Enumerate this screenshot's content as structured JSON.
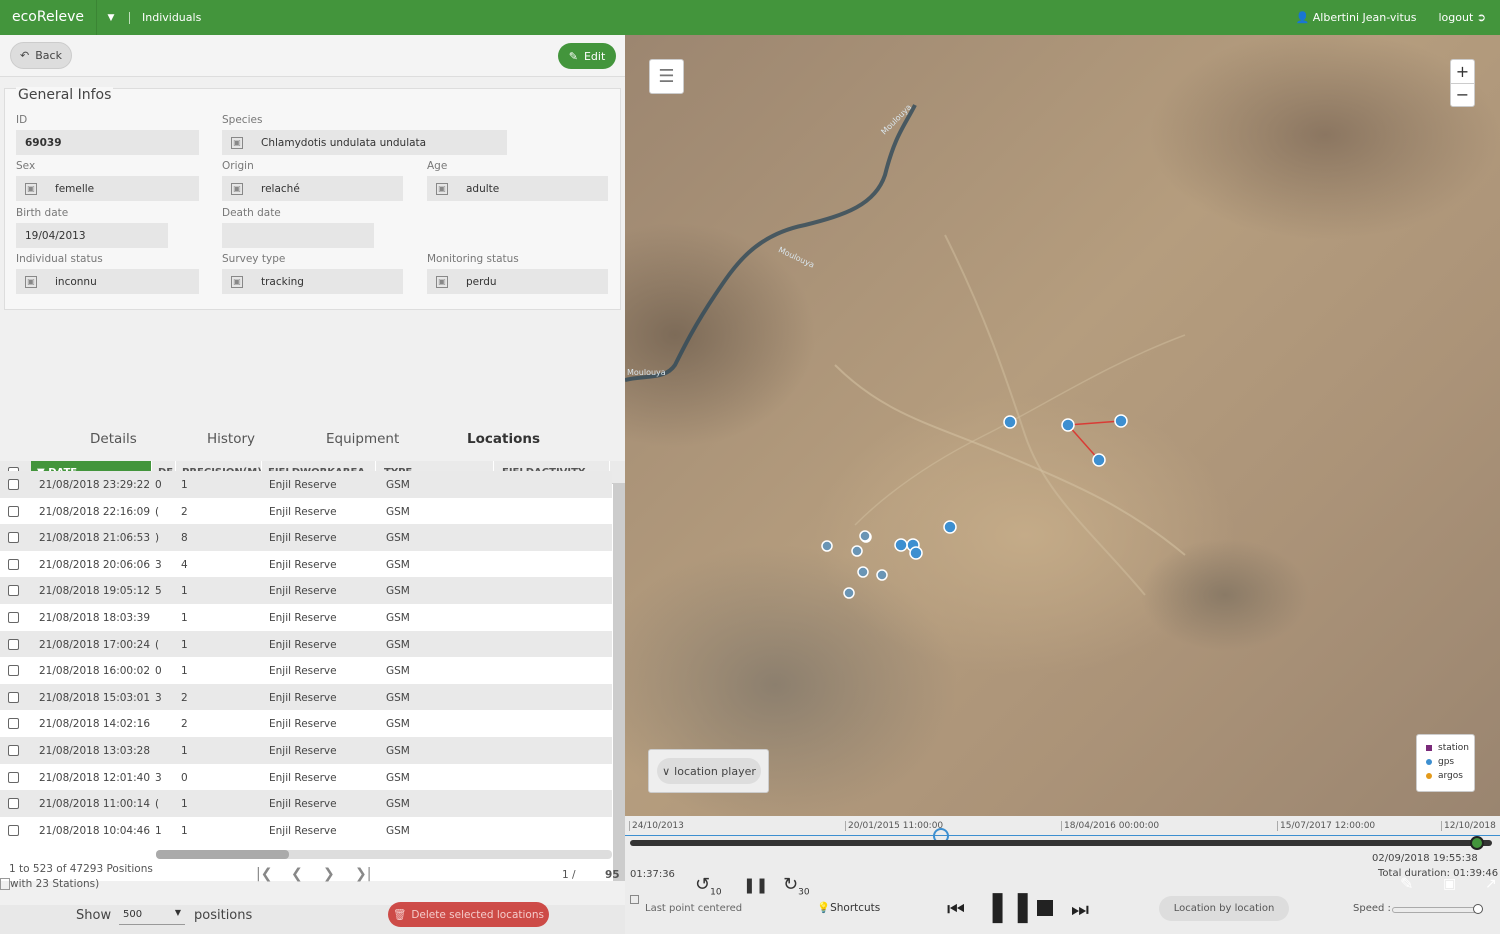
{
  "topbar": {
    "brand": "ecoReleve",
    "breadcrumb": "Individuals",
    "user": "Albertini Jean-vitus",
    "logout": "logout"
  },
  "actions": {
    "back": "Back",
    "edit": "Edit"
  },
  "general": {
    "title": "General Infos",
    "id_label": "ID",
    "id_value": "69039",
    "species_label": "Species",
    "species_value": "Chlamydotis undulata undulata",
    "sex_label": "Sex",
    "sex_value": "femelle",
    "origin_label": "Origin",
    "origin_value": "relaché",
    "age_label": "Age",
    "age_value": "adulte",
    "birth_label": "Birth date",
    "birth_value": "19/04/2013",
    "death_label": "Death date",
    "death_value": "",
    "status_label": "Individual status",
    "status_value": "inconnu",
    "survey_label": "Survey type",
    "survey_value": "tracking",
    "monitoring_label": "Monitoring status",
    "monitoring_value": "perdu"
  },
  "tabs": [
    "Details",
    "History",
    "Equipment",
    "Locations"
  ],
  "grid": {
    "columns": [
      "DATE",
      "DE",
      "PRECISION(M)",
      "FIELDWORKAREA",
      "TYPE",
      "FIELDACTIVITY"
    ],
    "rows": [
      [
        "21/08/2018 23:29:22",
        "0",
        "1",
        "Enjil Reserve",
        "GSM"
      ],
      [
        "21/08/2018 22:16:09",
        "(",
        "2",
        "Enjil Reserve",
        "GSM"
      ],
      [
        "21/08/2018 21:06:53",
        ")",
        "8",
        "Enjil Reserve",
        "GSM"
      ],
      [
        "21/08/2018 20:06:06",
        "3",
        "4",
        "Enjil Reserve",
        "GSM"
      ],
      [
        "21/08/2018 19:05:12",
        "5",
        "1",
        "Enjil Reserve",
        "GSM"
      ],
      [
        "21/08/2018 18:03:39",
        "",
        "1",
        "Enjil Reserve",
        "GSM"
      ],
      [
        "21/08/2018 17:00:24",
        "(",
        "1",
        "Enjil Reserve",
        "GSM"
      ],
      [
        "21/08/2018 16:00:02",
        "0",
        "1",
        "Enjil Reserve",
        "GSM"
      ],
      [
        "21/08/2018 15:03:01",
        "3",
        "2",
        "Enjil Reserve",
        "GSM"
      ],
      [
        "21/08/2018 14:02:16",
        "",
        "2",
        "Enjil Reserve",
        "GSM"
      ],
      [
        "21/08/2018 13:03:28",
        "",
        "1",
        "Enjil Reserve",
        "GSM"
      ],
      [
        "21/08/2018 12:01:40",
        "3",
        "0",
        "Enjil Reserve",
        "GSM"
      ],
      [
        "21/08/2018 11:00:14",
        "(",
        "1",
        "Enjil Reserve",
        "GSM"
      ],
      [
        "21/08/2018 10:04:46",
        "1",
        "1",
        "Enjil Reserve",
        "GSM"
      ]
    ]
  },
  "pager": {
    "summary": "1 to 523 of 47293 Positions",
    "summary2": "with 23 Stations)",
    "page": "1 /",
    "total": "95"
  },
  "footer": {
    "show": "Show",
    "show_value": "500",
    "positions": "positions",
    "delete": "Delete selected locations"
  },
  "map": {
    "river_labels": [
      "Moulouya",
      "Moulouya",
      "Moulouya"
    ],
    "location_player": "location player",
    "legend": [
      {
        "label": "station",
        "color": "#7a2a7a"
      },
      {
        "label": "gps",
        "color": "#3d8fd0"
      },
      {
        "label": "argos",
        "color": "#e39a1b"
      }
    ]
  },
  "timeline": {
    "ticks": [
      "24/10/2013",
      "20/01/2015 11:00:00",
      "18/04/2016 00:00:00",
      "15/07/2017 12:00:00",
      "12/10/2018"
    ],
    "elapsed": "01:37:36",
    "current": "02/09/2018 19:55:38",
    "total": "Total duration: 01:39:46",
    "back_label": "10",
    "fwd_label": "30",
    "last_point": "Last point centered",
    "shortcuts": "Shortcuts",
    "location_by_location": "Location by location",
    "speed": "Speed :"
  }
}
